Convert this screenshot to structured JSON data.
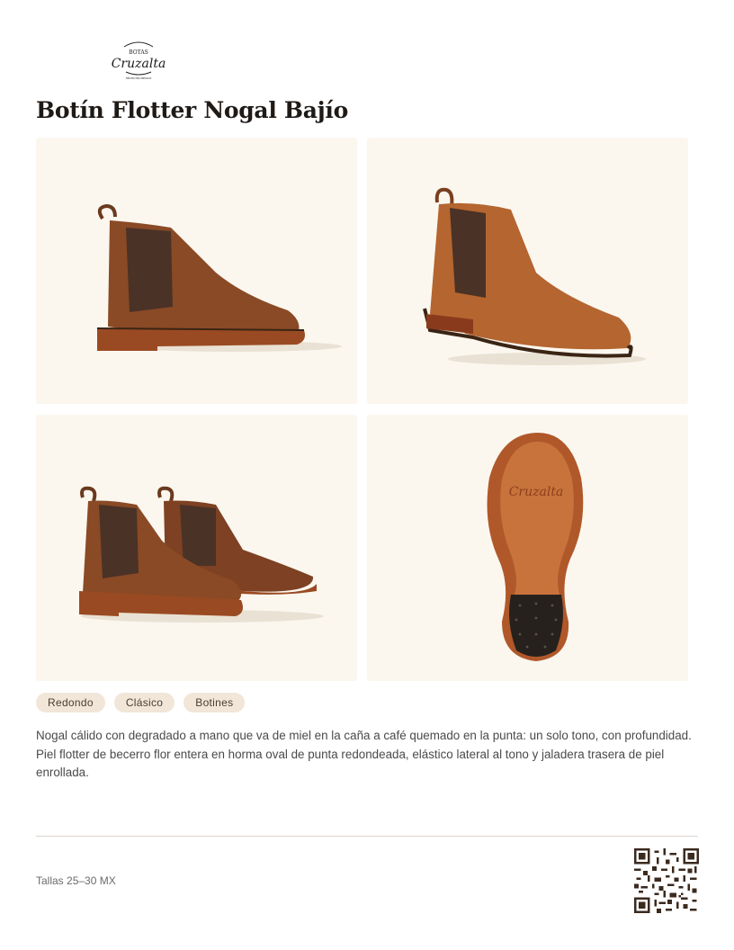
{
  "brand": {
    "logo_text_top": "BOTAS",
    "logo_text_main": "Cruzalta",
    "logo_text_bottom": "HECHO EN MÉXICO"
  },
  "product": {
    "title": "Botín Flotter Nogal Bajío",
    "images": [
      {
        "icon": "boot-side-view-icon"
      },
      {
        "icon": "boot-angled-view-icon"
      },
      {
        "icon": "boot-pair-view-icon"
      },
      {
        "icon": "boot-sole-view-icon"
      }
    ],
    "tags": [
      "Redondo",
      "Clásico",
      "Botines"
    ],
    "description": "Nogal cálido con degradado a mano que va de miel en la caña a café quemado en la punta: un solo tono, con profundidad. Piel flotter de becerro flor entera en horma oval de punta redondeada, elástico lateral al tono y jaladera trasera de piel enrollada.",
    "sizes": "Tallas 25–30 MX"
  },
  "qr": {
    "icon": "qr-code-icon"
  },
  "colors": {
    "tile_bg": "#fbf7ef",
    "tag_bg": "#f1e6d8",
    "leather": "#8a4a25",
    "leather_light": "#b5652f",
    "elastic": "#4a3226",
    "sole": "#9a4a22"
  }
}
